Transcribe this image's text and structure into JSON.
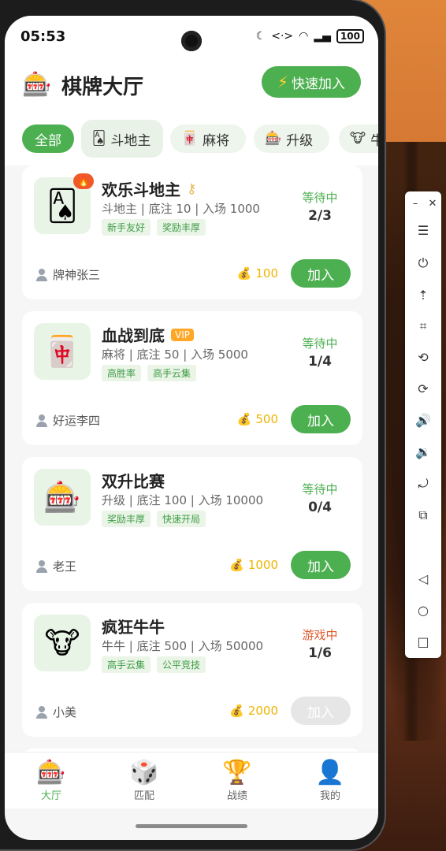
{
  "status": {
    "time": "05:53",
    "battery": "100",
    "signal_icon": "signal-icon",
    "wifi_icon": "wifi-icon"
  },
  "header": {
    "logo_icon": "slot-machine-icon",
    "title": "棋牌大厅",
    "quick_join_label": "快速加入"
  },
  "tabs": [
    {
      "label": "全部",
      "icon": ""
    },
    {
      "label": "斗地主",
      "icon": "card-icon"
    },
    {
      "label": "麻将",
      "icon": "mahjong-icon"
    },
    {
      "label": "升级",
      "icon": "slot-machine-icon"
    },
    {
      "label": "牛",
      "icon": "cow-icon"
    }
  ],
  "rooms": [
    {
      "name": "欢乐斗地主",
      "badge": "key",
      "hot": true,
      "desc": "斗地主 | 底注 10 | 入场 1000",
      "tags": [
        "新手友好",
        "奖励丰厚"
      ],
      "state": "等待中",
      "players": "2/3",
      "owner": "牌神张三",
      "coins": "100",
      "join": "加入",
      "joinable": true
    },
    {
      "name": "血战到底",
      "badge": "VIP",
      "hot": false,
      "desc": "麻将 | 底注 50 | 入场 5000",
      "tags": [
        "高胜率",
        "高手云集"
      ],
      "state": "等待中",
      "players": "1/4",
      "owner": "好运李四",
      "coins": "500",
      "join": "加入",
      "joinable": true
    },
    {
      "name": "双升比赛",
      "badge": "",
      "hot": false,
      "desc": "升级 | 底注 100 | 入场 10000",
      "tags": [
        "奖励丰厚",
        "快速开局"
      ],
      "state": "等待中",
      "players": "0/4",
      "owner": "老王",
      "coins": "1000",
      "join": "加入",
      "joinable": true
    },
    {
      "name": "疯狂牛牛",
      "badge": "",
      "hot": false,
      "desc": "牛牛 | 底注 500 | 入场 50000",
      "tags": [
        "高手云集",
        "公平竞技"
      ],
      "state": "游戏中",
      "players": "1/6",
      "owner": "小美",
      "coins": "2000",
      "join": "加入",
      "joinable": false
    }
  ],
  "nav": [
    {
      "label": "大厅",
      "icon": "slot-machine-icon"
    },
    {
      "label": "匹配",
      "icon": "dice-icon"
    },
    {
      "label": "战绩",
      "icon": "trophy-icon"
    },
    {
      "label": "我的",
      "icon": "user-icon"
    }
  ],
  "colors": {
    "accent": "#4caf50",
    "playing": "#e05a2a",
    "coin": "#f0b400"
  }
}
